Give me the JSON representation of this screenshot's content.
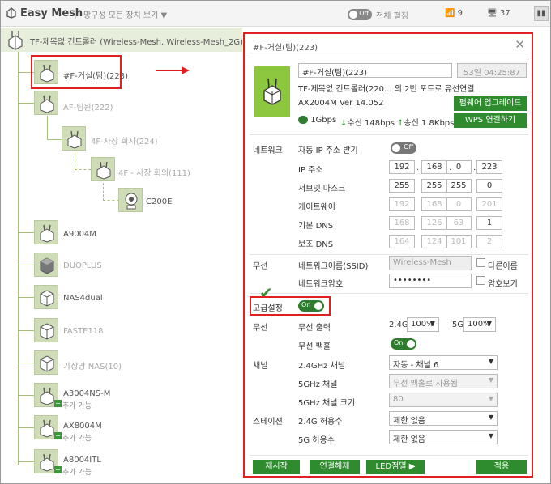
{
  "app": {
    "title": "Easy Mesh",
    "filter_label": "망구성 모든 장치 보기",
    "top_toggle_state": "Off",
    "top_toggle_label": "전체 펼침",
    "wifi_count": "9",
    "device_count": "37"
  },
  "tree": {
    "root_label": "TF-제목없 컨트롤러",
    "root_networks": "(Wireless-Mesh, Wireless-Mesh_2G)",
    "nodes": [
      {
        "label": "#F-거실(팀)(223)"
      },
      {
        "label": "AF-팀원(222)"
      },
      {
        "label": "4F-사장 회사(224)"
      },
      {
        "label": "4F - 사장 회의(111)"
      },
      {
        "label": "C200E"
      },
      {
        "label": "A9004M"
      },
      {
        "label": "DUOPLUS"
      },
      {
        "label": "NAS4dual"
      },
      {
        "label": "FASTE118"
      },
      {
        "label": "가상망 NAS(10)"
      },
      {
        "label": "A3004NS-M",
        "sub": "추가 가능"
      },
      {
        "label": "AX8004M",
        "sub": "추가 가능"
      },
      {
        "label": "A8004ITL",
        "sub": "추가 가능"
      }
    ]
  },
  "panel": {
    "title": "#F-거실(팀)(223)",
    "name_value": "#F-거실(팀)(223)",
    "uptime": "53일 04:25:87",
    "connection": "TF-제목없 컨트롤러(220... 의 2번 포트로 유선연결",
    "model": "AX2004M",
    "version": "Ver 14.052",
    "link_speed": "1Gbps",
    "rx_label": "수신",
    "rx_value": "148bps",
    "tx_label": "송신",
    "tx_value": "1.8Kbps",
    "firmware_button": "펌웨어 업그레이드",
    "wps_button": "WPS 연결하기",
    "network_section": "네트워크",
    "auto_ip_label": "자동 IP 주소 받기",
    "auto_ip_toggle": "Off",
    "ip_label": "IP 주소",
    "ip": [
      "192",
      "168",
      "0",
      "223"
    ],
    "subnet_label": "서브넷 마스크",
    "subnet": [
      "255",
      "255",
      "255",
      "0"
    ],
    "gateway_label": "게이트웨이",
    "gateway": [
      "192",
      "168",
      "0",
      "201"
    ],
    "dns1_label": "기본 DNS",
    "dns1": [
      "168",
      "126",
      "63",
      "1"
    ],
    "dns2_label": "보조 DNS",
    "dns2": [
      "164",
      "124",
      "101",
      "2"
    ],
    "wireless_section": "무선",
    "ssid_label": "네트워크이름(SSID)",
    "ssid_value": "Wireless-Mesh",
    "diff_name_label": "다른이름",
    "password_label": "네트워크암호",
    "password_value": "••••••••",
    "show_pw_label": "암호보기",
    "advanced_label": "고급설정",
    "advanced_toggle": "On",
    "adv_wireless_section": "무선",
    "tx_power_label": "무선 출력",
    "band_2g": "2.4G",
    "band_2g_value": "100%",
    "band_5g": "5G",
    "band_5g_value": "100%",
    "backhaul_label": "무선 백홀",
    "backhaul_toggle": "On",
    "channel_section": "채널",
    "ch24_label": "2.4GHz 채널",
    "ch24_value": "자동 - 채널 6",
    "ch5_label": "5GHz 채널",
    "ch5_value": "무선 백홀로 사용됨",
    "ch5w_label": "5GHz 채널 크기",
    "ch5w_value": "80",
    "station_section": "스테이션",
    "st24_label": "2.4G 허용수",
    "st24_value": "제한 없음",
    "st5_label": "5G 허용수",
    "st5_value": "제한 없음",
    "buttons": {
      "restart": "재시작",
      "disconnect": "연결해제",
      "led": "LED점멸",
      "apply": "적용"
    }
  },
  "colors": {
    "accent_green": "#2e8b2e",
    "node_green": "#8dc63f",
    "highlight_red": "#e02020"
  }
}
